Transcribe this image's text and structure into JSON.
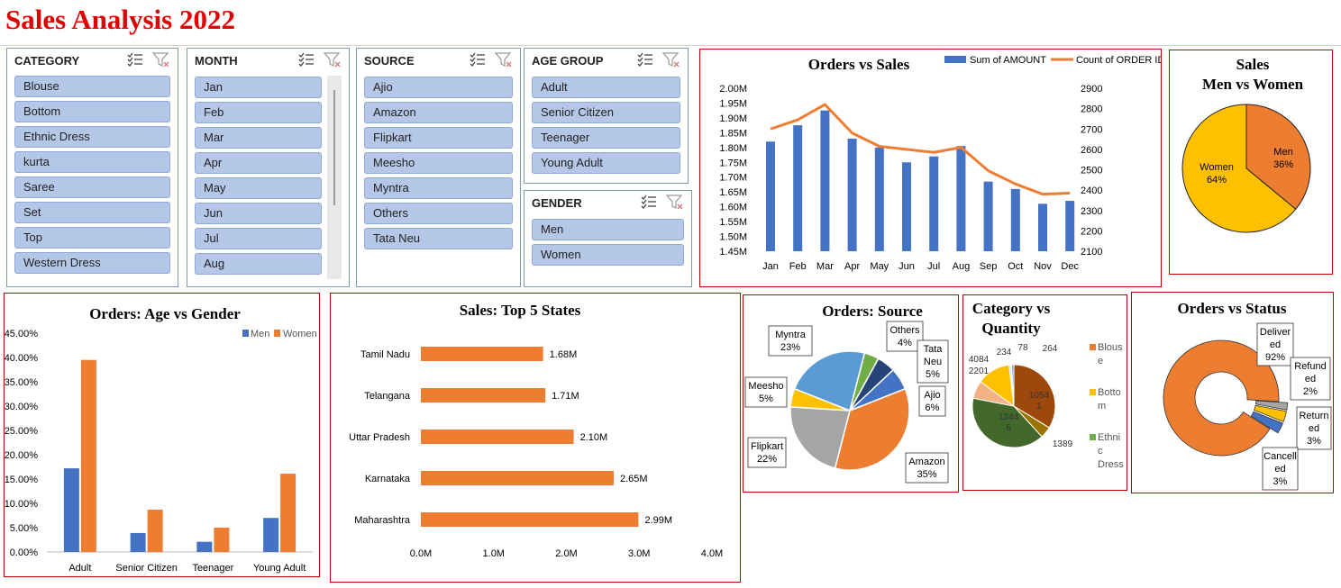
{
  "page_title": "Sales Analysis 2022",
  "slicers": {
    "category": {
      "header": "CATEGORY",
      "items": [
        "Blouse",
        "Bottom",
        "Ethnic Dress",
        "kurta",
        "Saree",
        "Set",
        "Top",
        "Western Dress"
      ]
    },
    "month": {
      "header": "MONTH",
      "items": [
        "Jan",
        "Feb",
        "Mar",
        "Apr",
        "May",
        "Jun",
        "Jul",
        "Aug"
      ]
    },
    "source": {
      "header": "SOURCE",
      "items": [
        "Ajio",
        "Amazon",
        "Flipkart",
        "Meesho",
        "Myntra",
        "Others",
        "Tata Neu"
      ]
    },
    "age_group": {
      "header": "AGE GROUP",
      "items": [
        "Adult",
        "Senior Citizen",
        "Teenager",
        "Young Adult"
      ]
    },
    "gender": {
      "header": "GENDER",
      "items": [
        "Men",
        "Women"
      ]
    }
  },
  "colors": {
    "blue": "#4472c4",
    "orange": "#ed7d31",
    "gray": "#a5a5a5",
    "yellow": "#ffc000",
    "lightblue": "#5b9bd5",
    "green": "#70ad47",
    "darkblue": "#264478",
    "brown": "#9e480e",
    "darkgreen": "#43682b",
    "olive": "#997300",
    "panel_border": "#c00000",
    "title_red": "#e00000"
  },
  "chart_data": [
    {
      "id": "orders_vs_sales",
      "type": "bar",
      "title": "Orders vs Sales",
      "categories": [
        "Jan",
        "Feb",
        "Mar",
        "Apr",
        "May",
        "Jun",
        "Jul",
        "Aug",
        "Sep",
        "Oct",
        "Nov",
        "Dec"
      ],
      "series": [
        {
          "name": "Sum of AMOUNT",
          "type": "bar",
          "axis": "left",
          "values": [
            1.82,
            1.875,
            1.925,
            1.83,
            1.8,
            1.75,
            1.77,
            1.805,
            1.685,
            1.66,
            1.61,
            1.62
          ]
        },
        {
          "name": "Count of ORDER ID",
          "type": "line",
          "axis": "right",
          "values": [
            2700,
            2745,
            2820,
            2680,
            2615,
            2600,
            2585,
            2610,
            2495,
            2430,
            2380,
            2385
          ]
        }
      ],
      "y_left": {
        "min": 1.45,
        "max": 2.0,
        "ticks": [
          "1.45M",
          "1.50M",
          "1.55M",
          "1.60M",
          "1.65M",
          "1.70M",
          "1.75M",
          "1.80M",
          "1.85M",
          "1.90M",
          "1.95M",
          "2.00M"
        ]
      },
      "y_right": {
        "min": 2100,
        "max": 2900,
        "ticks": [
          "2100",
          "2200",
          "2300",
          "2400",
          "2500",
          "2600",
          "2700",
          "2800",
          "2900"
        ]
      },
      "legend": "top-right"
    },
    {
      "id": "sales_men_women",
      "type": "pie",
      "title_lines": [
        "Sales",
        "Men vs Women"
      ],
      "slices": [
        {
          "label": "Men",
          "pct_label": "36%",
          "value": 36
        },
        {
          "label": "Women",
          "pct_label": "64%",
          "value": 64
        }
      ]
    },
    {
      "id": "orders_age_gender",
      "type": "bar",
      "title": "Orders: Age vs Gender",
      "categories": [
        "Adult",
        "Senior Citizen",
        "Teenager",
        "Young Adult"
      ],
      "series": [
        {
          "name": "Men",
          "values": [
            17.2,
            3.9,
            2.1,
            7.0
          ]
        },
        {
          "name": "Women",
          "values": [
            39.5,
            8.7,
            5.0,
            16.1
          ]
        }
      ],
      "ylim": [
        0,
        45
      ],
      "y_ticks": [
        "0.00%",
        "5.00%",
        "10.00%",
        "15.00%",
        "20.00%",
        "25.00%",
        "30.00%",
        "35.00%",
        "40.00%",
        "45.00%"
      ],
      "legend": "top-right"
    },
    {
      "id": "sales_top5_states",
      "type": "bar",
      "orientation": "horizontal",
      "title": "Sales: Top 5 States",
      "categories": [
        "Tamil Nadu",
        "Telangana",
        "Uttar Pradesh",
        "Karnataka",
        "Maharashtra"
      ],
      "values": [
        1.68,
        1.71,
        2.1,
        2.65,
        2.99
      ],
      "value_labels": [
        "1.68M",
        "1.71M",
        "2.10M",
        "2.65M",
        "2.99M"
      ],
      "xlim": [
        0,
        4
      ],
      "x_ticks": [
        "0.0M",
        "1.0M",
        "2.0M",
        "3.0M",
        "4.0M"
      ]
    },
    {
      "id": "orders_source",
      "type": "pie",
      "title": "Orders: Source",
      "slices": [
        {
          "label": "Amazon",
          "pct_label": "35%",
          "value": 35
        },
        {
          "label": "Flipkart",
          "pct_label": "22%",
          "value": 22
        },
        {
          "label": "Meesho",
          "pct_label": "5%",
          "value": 5
        },
        {
          "label": "Myntra",
          "pct_label": "23%",
          "value": 23
        },
        {
          "label": "Others",
          "pct_label": "4%",
          "value": 4
        },
        {
          "label": "Tata Neu",
          "pct_label": "5%",
          "value": 5
        },
        {
          "label": "Ajio",
          "pct_label": "6%",
          "value": 6
        }
      ]
    },
    {
      "id": "category_vs_quantity",
      "type": "pie",
      "title_lines": [
        "Category vs",
        "Quantity"
      ],
      "slices": [
        {
          "label": "Blouse",
          "value": 10541,
          "data_label": "10541"
        },
        {
          "label": "Bottom",
          "value": 1389,
          "data_label": "1389"
        },
        {
          "label": "Ethnic Dress",
          "value": 12446,
          "data_label": "12446"
        },
        {
          "label": "",
          "value": 2201,
          "data_label": "2201"
        },
        {
          "label": "",
          "value": 4084,
          "data_label": "4084"
        },
        {
          "label": "",
          "value": 234,
          "data_label": "234"
        },
        {
          "label": "",
          "value": 78,
          "data_label": "78"
        },
        {
          "label": "",
          "value": 264,
          "data_label": "264"
        }
      ],
      "legend_entries": [
        [
          "Blous",
          "e"
        ],
        [
          "Botto",
          "m"
        ],
        [
          "Ethni",
          "c",
          "Dress"
        ]
      ]
    },
    {
      "id": "orders_vs_status",
      "type": "pie",
      "title": "Orders vs Status",
      "slices": [
        {
          "label": "Delivered",
          "label_lines": [
            "Deliver",
            "ed",
            "92%"
          ],
          "value": 92
        },
        {
          "label": "Refunded",
          "label_lines": [
            "Refund",
            "ed",
            "2%"
          ],
          "value": 2
        },
        {
          "label": "Returned",
          "label_lines": [
            "Return",
            "ed",
            "3%"
          ],
          "value": 3
        },
        {
          "label": "Cancelled",
          "label_lines": [
            "Cancell",
            "ed",
            "3%"
          ],
          "value": 3
        }
      ]
    }
  ]
}
